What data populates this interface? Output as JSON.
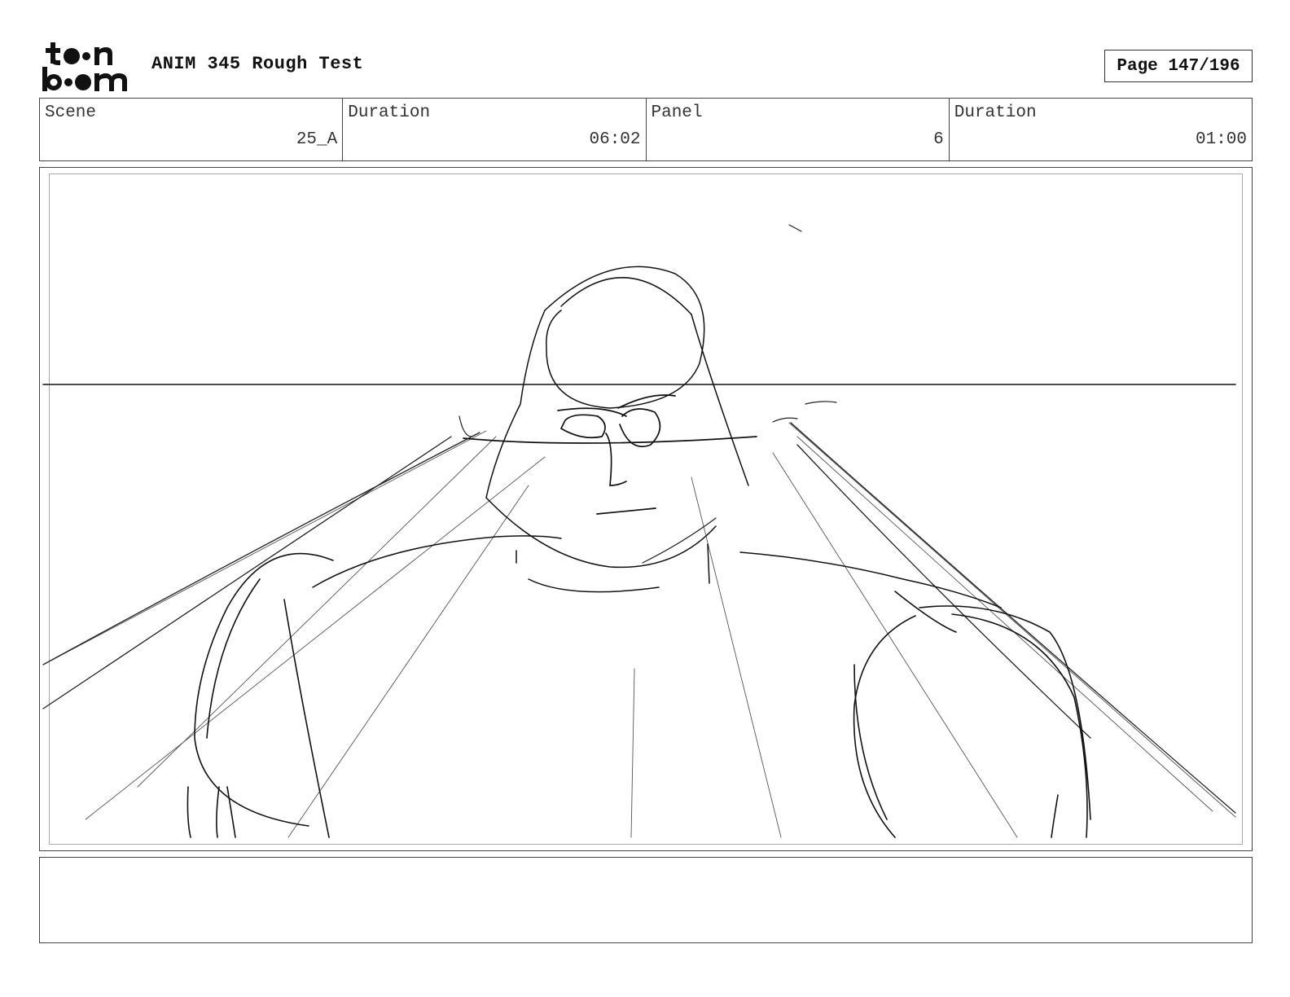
{
  "header": {
    "logo": {
      "line1": "toon",
      "line2": "boom"
    },
    "title": "ANIM 345 Rough Test",
    "page_label": "Page 147/196"
  },
  "info": {
    "scene": {
      "label": "Scene",
      "value": "25_A"
    },
    "scene_duration": {
      "label": "Duration",
      "value": "06:02"
    },
    "panel": {
      "label": "Panel",
      "value": "6"
    },
    "panel_duration": {
      "label": "Duration",
      "value": "01:00"
    }
  },
  "notes": {
    "text": ""
  }
}
